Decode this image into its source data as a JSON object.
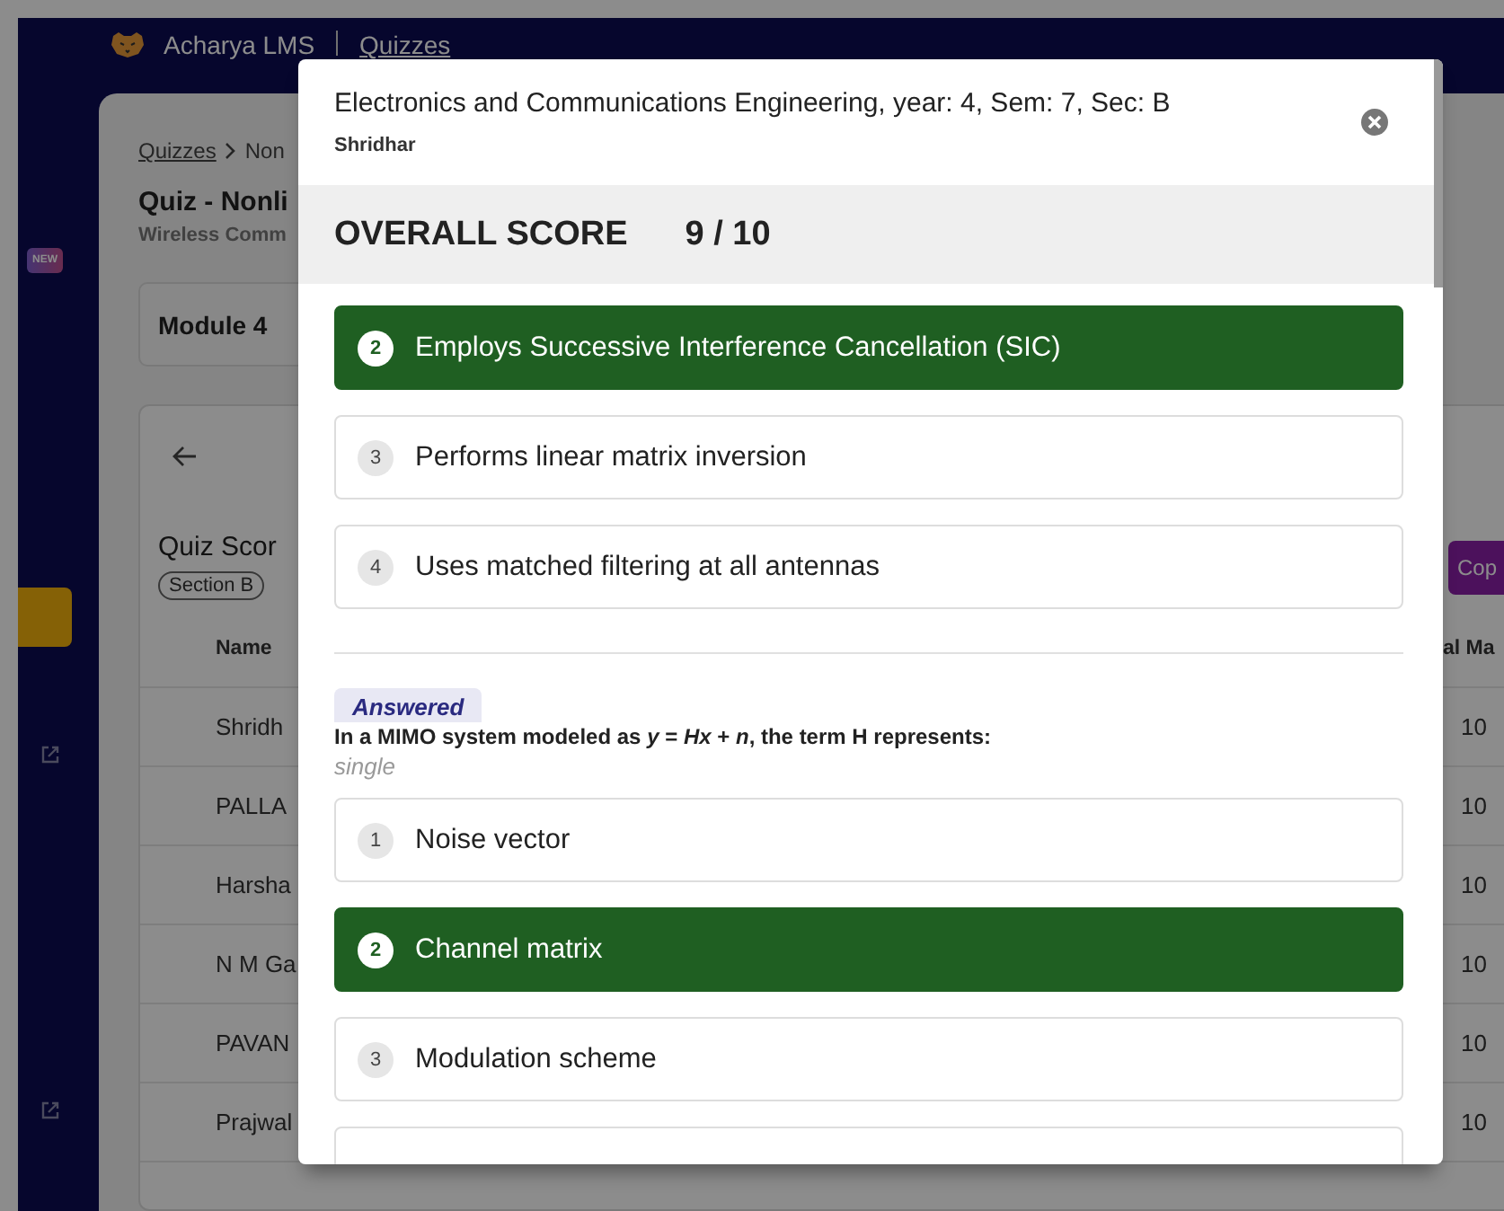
{
  "app": {
    "brand": "Acharya LMS",
    "section": "Quizzes"
  },
  "sidebar": {
    "badge": "NEW"
  },
  "background": {
    "breadcrumb": {
      "link": "Quizzes",
      "current": "Non"
    },
    "title": "Quiz - Nonli",
    "subtitle": "Wireless Comm",
    "module": "Module 4",
    "card_title": "Quiz Scor",
    "chips": [
      "Section B"
    ],
    "copy_button": "Cop",
    "table": {
      "columns": [
        "Name",
        "al Ma"
      ],
      "rows": [
        {
          "name": "Shridh",
          "marks": "10"
        },
        {
          "name": "PALLA",
          "marks": "10"
        },
        {
          "name": "Harsha",
          "marks": "10"
        },
        {
          "name": "N M Ga",
          "marks": "10"
        },
        {
          "name": "PAVAN",
          "marks": "10"
        },
        {
          "name": "Prajwal",
          "marks": "10"
        }
      ]
    }
  },
  "modal": {
    "title": "Electronics and Communications Engineering, year: 4, Sem: 7, Sec: B",
    "subtitle": "Shridhar",
    "score_label": "OVERALL SCORE",
    "score": "9 / 10",
    "questions": [
      {
        "options": [
          {
            "number": "2",
            "text": "Employs Successive Interference Cancellation (SIC)",
            "selected": true
          },
          {
            "number": "3",
            "text": "Performs linear matrix inversion",
            "selected": false
          },
          {
            "number": "4",
            "text": "Uses matched filtering at all antennas",
            "selected": false
          }
        ]
      },
      {
        "status": "Answered",
        "text": "In a MIMO system modeled as *y* = *Hx* + *n*, the term H represents:",
        "type": "single",
        "more_below": true,
        "options": [
          {
            "number": "1",
            "text": "Noise vector",
            "selected": false
          },
          {
            "number": "2",
            "text": "Channel matrix",
            "selected": true
          },
          {
            "number": "3",
            "text": "Modulation scheme",
            "selected": false
          }
        ]
      }
    ]
  }
}
